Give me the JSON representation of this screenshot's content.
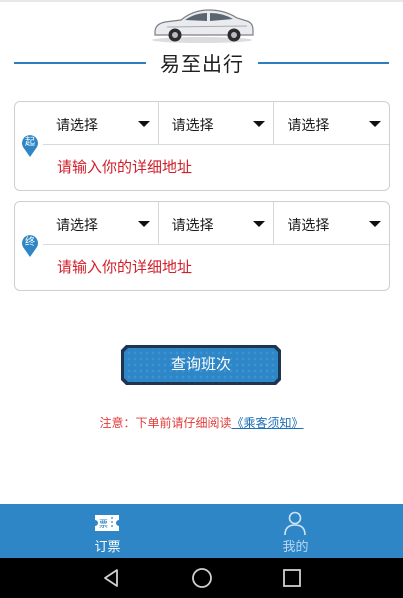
{
  "header": {
    "title": "易至出行",
    "accent_color": "#2d7dc0",
    "car_icon": "car-icon"
  },
  "start": {
    "marker": "起",
    "marker_icon": "map-pin-icon",
    "selects": [
      "请选择",
      "请选择",
      "请选择"
    ],
    "address_placeholder": "请输入你的详细地址"
  },
  "end": {
    "marker": "终",
    "marker_icon": "map-pin-icon",
    "selects": [
      "请选择",
      "请选择",
      "请选择"
    ],
    "address_placeholder": "请输入你的详细地址"
  },
  "query_button": {
    "label": "查询班次",
    "color": "#2f86c6"
  },
  "notice": {
    "text": "注意：下单前请仔细阅读",
    "link": "《乘客须知》",
    "text_color": "#e23a3a",
    "link_color": "#1d6fb8"
  },
  "tabbar": {
    "background": "#2f86c6",
    "tabs": [
      {
        "label": "订票",
        "icon": "ticket-icon",
        "active": true
      },
      {
        "label": "我的",
        "icon": "person-icon",
        "active": false
      }
    ]
  },
  "navbar": {
    "buttons": [
      "back-icon",
      "home-icon",
      "recents-icon"
    ]
  }
}
